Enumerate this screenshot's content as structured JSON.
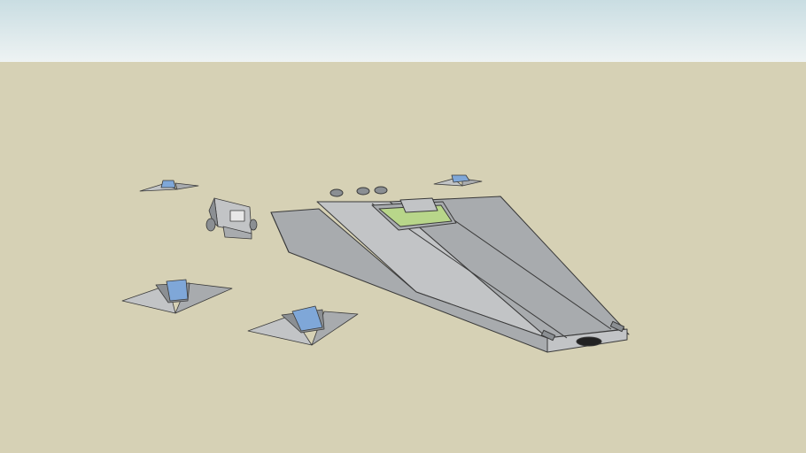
{
  "scene": {
    "colors": {
      "sky_top": "#c9dde2",
      "sky_bottom": "#eef3f3",
      "ground": "#d6d1b5",
      "hull_light": "#c2c4c6",
      "hull_mid": "#a8abae",
      "hull_dark": "#8b8f93",
      "edge": "#3a3a3a",
      "panel_green": "#b8d68a",
      "cockpit_blue": "#7fa7d8"
    },
    "objects": [
      {
        "id": "capital-ship",
        "icon": "starship-model"
      },
      {
        "id": "fighter-far-left",
        "icon": "fighter-model"
      },
      {
        "id": "fighter-far-right",
        "icon": "fighter-model"
      },
      {
        "id": "fighter-near-left",
        "icon": "fighter-model"
      },
      {
        "id": "fighter-near-center",
        "icon": "fighter-model"
      },
      {
        "id": "cargo-shuttle",
        "icon": "shuttle-model"
      }
    ]
  }
}
